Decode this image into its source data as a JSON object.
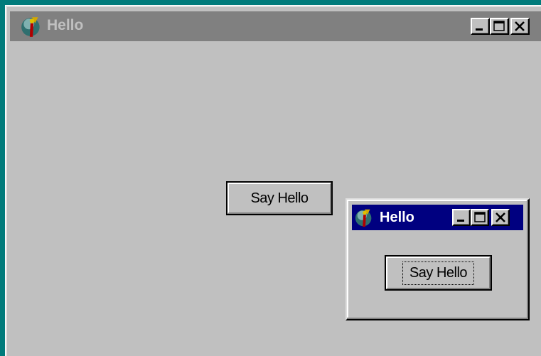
{
  "main_window": {
    "title": "Hello",
    "icon": "app-icon",
    "state": "inactive",
    "titlebar_color": "#808080",
    "controls": [
      "minimize-icon",
      "maximize-icon",
      "close-icon"
    ],
    "button_label": "Say Hello"
  },
  "dialog_window": {
    "title": "Hello",
    "icon": "app-icon",
    "state": "active",
    "titlebar_color": "#000080",
    "controls": [
      "minimize-icon",
      "maximize-icon",
      "close-icon"
    ],
    "button_label": "Say Hello",
    "button_focused": true
  },
  "colors": {
    "desktop": "#007b7b",
    "face": "#c0c0c0",
    "active_title": "#000080",
    "inactive_title": "#808080"
  }
}
